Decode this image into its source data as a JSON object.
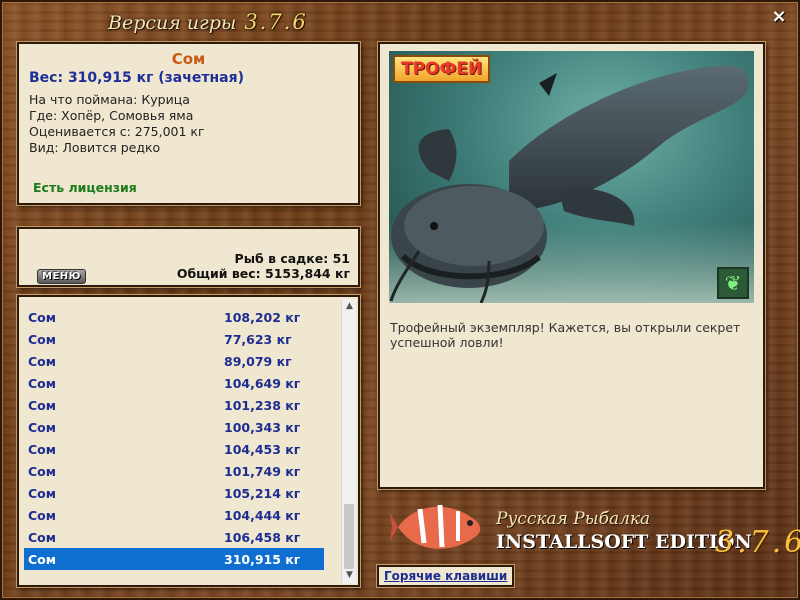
{
  "window": {
    "title": "Версия игры",
    "version": "3.7.6",
    "close": "×"
  },
  "info": {
    "fish_name": "Сом",
    "weight": "Вес: 310,915 кг (зачетная)",
    "lines": [
      "На что поймана: Курица",
      "Где: Хопёр, Сомовья яма",
      "Оценивается с: 275,001 кг",
      "Вид: Ловится редко"
    ],
    "license": "Есть лицензия"
  },
  "middle": {
    "menu": "МЕНЮ",
    "fish_in_cage": "Рыб в садке: 51",
    "total_weight": "Общий вес: 5153,844 кг"
  },
  "catch_list": [
    {
      "name": "Сом",
      "weight": "108,202 кг"
    },
    {
      "name": "Сом",
      "weight": "77,623 кг"
    },
    {
      "name": "Сом",
      "weight": "89,079 кг"
    },
    {
      "name": "Сом",
      "weight": "104,649 кг"
    },
    {
      "name": "Сом",
      "weight": "101,238 кг"
    },
    {
      "name": "Сом",
      "weight": "100,343 кг"
    },
    {
      "name": "Сом",
      "weight": "104,453 кг"
    },
    {
      "name": "Сом",
      "weight": "101,749 кг"
    },
    {
      "name": "Сом",
      "weight": "105,214 кг"
    },
    {
      "name": "Сом",
      "weight": "104,444 кг"
    },
    {
      "name": "Сом",
      "weight": "106,458 кг"
    },
    {
      "name": "Сом",
      "weight": "310,915 кг"
    }
  ],
  "selected_index": 11,
  "photo": {
    "badge": "ТРОФЕЙ",
    "icon": "butterfly-icon"
  },
  "description": "Трофейный экземпляр! Кажется, вы открыли секрет успешной ловли!",
  "logo": {
    "game": "Русская Рыбалка",
    "edition": "INSTALLSOFT EDITION",
    "version": "3.7.6"
  },
  "hotkeys": "Горячие клавиши",
  "colors": {
    "accent_orange": "#c85a16",
    "accent_blue": "#1e2d92",
    "license_green": "#1d7a1d",
    "selection": "#0e6fd0"
  }
}
